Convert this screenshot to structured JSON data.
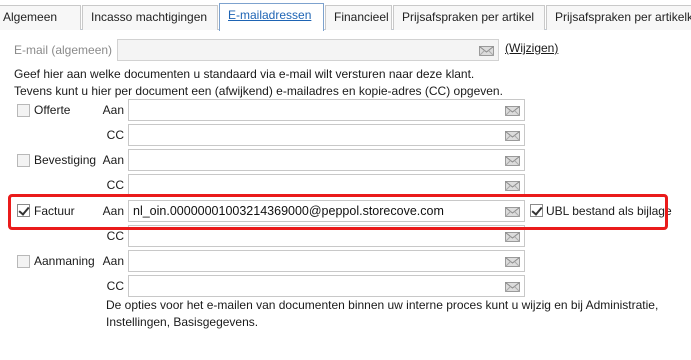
{
  "tabs": [
    {
      "label": "Algemeen",
      "active": false
    },
    {
      "label": "Incasso machtigingen",
      "active": false
    },
    {
      "label": "E-mailadressen",
      "active": true
    },
    {
      "label": "Financieel",
      "active": false
    },
    {
      "label": "Prijsafspraken per artikel",
      "active": false
    },
    {
      "label": "Prijsafspraken per artikelk",
      "active": false
    }
  ],
  "general": {
    "label": "E-mail (algemeen)",
    "value": "",
    "change_link": "(Wijzigen)"
  },
  "info": {
    "line1": "Geef hier aan welke documenten u standaard via e-mail wilt versturen naar deze klant.",
    "line2": "Tevens kunt u hier per document een (afwijkend) e-mailadres en kopie-adres (CC) opgeven."
  },
  "labels": {
    "to": "Aan",
    "cc": "CC"
  },
  "documents": [
    {
      "name": "Offerte",
      "checked": false,
      "to": "",
      "cc": ""
    },
    {
      "name": "Bevestiging",
      "checked": false,
      "to": "",
      "cc": ""
    },
    {
      "name": "Factuur",
      "checked": true,
      "to": "nl_oin.00000001003214369000@peppol.storecove.com",
      "cc": ""
    },
    {
      "name": "Aanmaning",
      "checked": false,
      "to": "",
      "cc": ""
    }
  ],
  "ubl": {
    "label": "UBL bestand als bijlage",
    "checked": true
  },
  "footer": {
    "line1": "De opties voor het e-mailen van documenten binnen uw interne proces kunt u wijzig en bij Administratie,",
    "line2": "Instellingen, Basisgegevens."
  },
  "colors": {
    "accent": "#1e64b4",
    "highlight": "#ea1b1b"
  }
}
